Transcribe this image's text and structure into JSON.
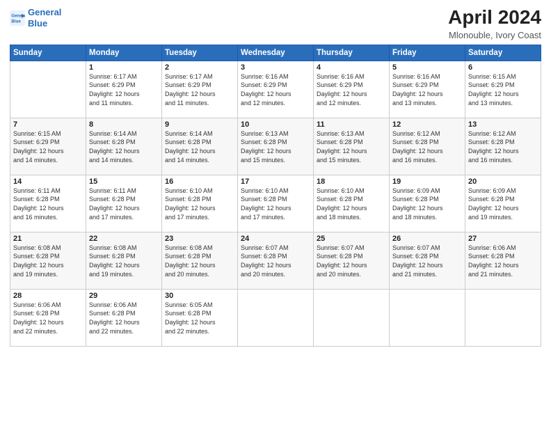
{
  "logo": {
    "line1": "General",
    "line2": "Blue"
  },
  "title": "April 2024",
  "subtitle": "Mlonouble, Ivory Coast",
  "weekdays": [
    "Sunday",
    "Monday",
    "Tuesday",
    "Wednesday",
    "Thursday",
    "Friday",
    "Saturday"
  ],
  "weeks": [
    [
      {
        "day": "",
        "info": ""
      },
      {
        "day": "1",
        "info": "Sunrise: 6:17 AM\nSunset: 6:29 PM\nDaylight: 12 hours\nand 11 minutes."
      },
      {
        "day": "2",
        "info": "Sunrise: 6:17 AM\nSunset: 6:29 PM\nDaylight: 12 hours\nand 11 minutes."
      },
      {
        "day": "3",
        "info": "Sunrise: 6:16 AM\nSunset: 6:29 PM\nDaylight: 12 hours\nand 12 minutes."
      },
      {
        "day": "4",
        "info": "Sunrise: 6:16 AM\nSunset: 6:29 PM\nDaylight: 12 hours\nand 12 minutes."
      },
      {
        "day": "5",
        "info": "Sunrise: 6:16 AM\nSunset: 6:29 PM\nDaylight: 12 hours\nand 13 minutes."
      },
      {
        "day": "6",
        "info": "Sunrise: 6:15 AM\nSunset: 6:29 PM\nDaylight: 12 hours\nand 13 minutes."
      }
    ],
    [
      {
        "day": "7",
        "info": "Sunrise: 6:15 AM\nSunset: 6:29 PM\nDaylight: 12 hours\nand 14 minutes."
      },
      {
        "day": "8",
        "info": "Sunrise: 6:14 AM\nSunset: 6:28 PM\nDaylight: 12 hours\nand 14 minutes."
      },
      {
        "day": "9",
        "info": "Sunrise: 6:14 AM\nSunset: 6:28 PM\nDaylight: 12 hours\nand 14 minutes."
      },
      {
        "day": "10",
        "info": "Sunrise: 6:13 AM\nSunset: 6:28 PM\nDaylight: 12 hours\nand 15 minutes."
      },
      {
        "day": "11",
        "info": "Sunrise: 6:13 AM\nSunset: 6:28 PM\nDaylight: 12 hours\nand 15 minutes."
      },
      {
        "day": "12",
        "info": "Sunrise: 6:12 AM\nSunset: 6:28 PM\nDaylight: 12 hours\nand 16 minutes."
      },
      {
        "day": "13",
        "info": "Sunrise: 6:12 AM\nSunset: 6:28 PM\nDaylight: 12 hours\nand 16 minutes."
      }
    ],
    [
      {
        "day": "14",
        "info": "Sunrise: 6:11 AM\nSunset: 6:28 PM\nDaylight: 12 hours\nand 16 minutes."
      },
      {
        "day": "15",
        "info": "Sunrise: 6:11 AM\nSunset: 6:28 PM\nDaylight: 12 hours\nand 17 minutes."
      },
      {
        "day": "16",
        "info": "Sunrise: 6:10 AM\nSunset: 6:28 PM\nDaylight: 12 hours\nand 17 minutes."
      },
      {
        "day": "17",
        "info": "Sunrise: 6:10 AM\nSunset: 6:28 PM\nDaylight: 12 hours\nand 17 minutes."
      },
      {
        "day": "18",
        "info": "Sunrise: 6:10 AM\nSunset: 6:28 PM\nDaylight: 12 hours\nand 18 minutes."
      },
      {
        "day": "19",
        "info": "Sunrise: 6:09 AM\nSunset: 6:28 PM\nDaylight: 12 hours\nand 18 minutes."
      },
      {
        "day": "20",
        "info": "Sunrise: 6:09 AM\nSunset: 6:28 PM\nDaylight: 12 hours\nand 19 minutes."
      }
    ],
    [
      {
        "day": "21",
        "info": "Sunrise: 6:08 AM\nSunset: 6:28 PM\nDaylight: 12 hours\nand 19 minutes."
      },
      {
        "day": "22",
        "info": "Sunrise: 6:08 AM\nSunset: 6:28 PM\nDaylight: 12 hours\nand 19 minutes."
      },
      {
        "day": "23",
        "info": "Sunrise: 6:08 AM\nSunset: 6:28 PM\nDaylight: 12 hours\nand 20 minutes."
      },
      {
        "day": "24",
        "info": "Sunrise: 6:07 AM\nSunset: 6:28 PM\nDaylight: 12 hours\nand 20 minutes."
      },
      {
        "day": "25",
        "info": "Sunrise: 6:07 AM\nSunset: 6:28 PM\nDaylight: 12 hours\nand 20 minutes."
      },
      {
        "day": "26",
        "info": "Sunrise: 6:07 AM\nSunset: 6:28 PM\nDaylight: 12 hours\nand 21 minutes."
      },
      {
        "day": "27",
        "info": "Sunrise: 6:06 AM\nSunset: 6:28 PM\nDaylight: 12 hours\nand 21 minutes."
      }
    ],
    [
      {
        "day": "28",
        "info": "Sunrise: 6:06 AM\nSunset: 6:28 PM\nDaylight: 12 hours\nand 22 minutes."
      },
      {
        "day": "29",
        "info": "Sunrise: 6:06 AM\nSunset: 6:28 PM\nDaylight: 12 hours\nand 22 minutes."
      },
      {
        "day": "30",
        "info": "Sunrise: 6:05 AM\nSunset: 6:28 PM\nDaylight: 12 hours\nand 22 minutes."
      },
      {
        "day": "",
        "info": ""
      },
      {
        "day": "",
        "info": ""
      },
      {
        "day": "",
        "info": ""
      },
      {
        "day": "",
        "info": ""
      }
    ]
  ]
}
